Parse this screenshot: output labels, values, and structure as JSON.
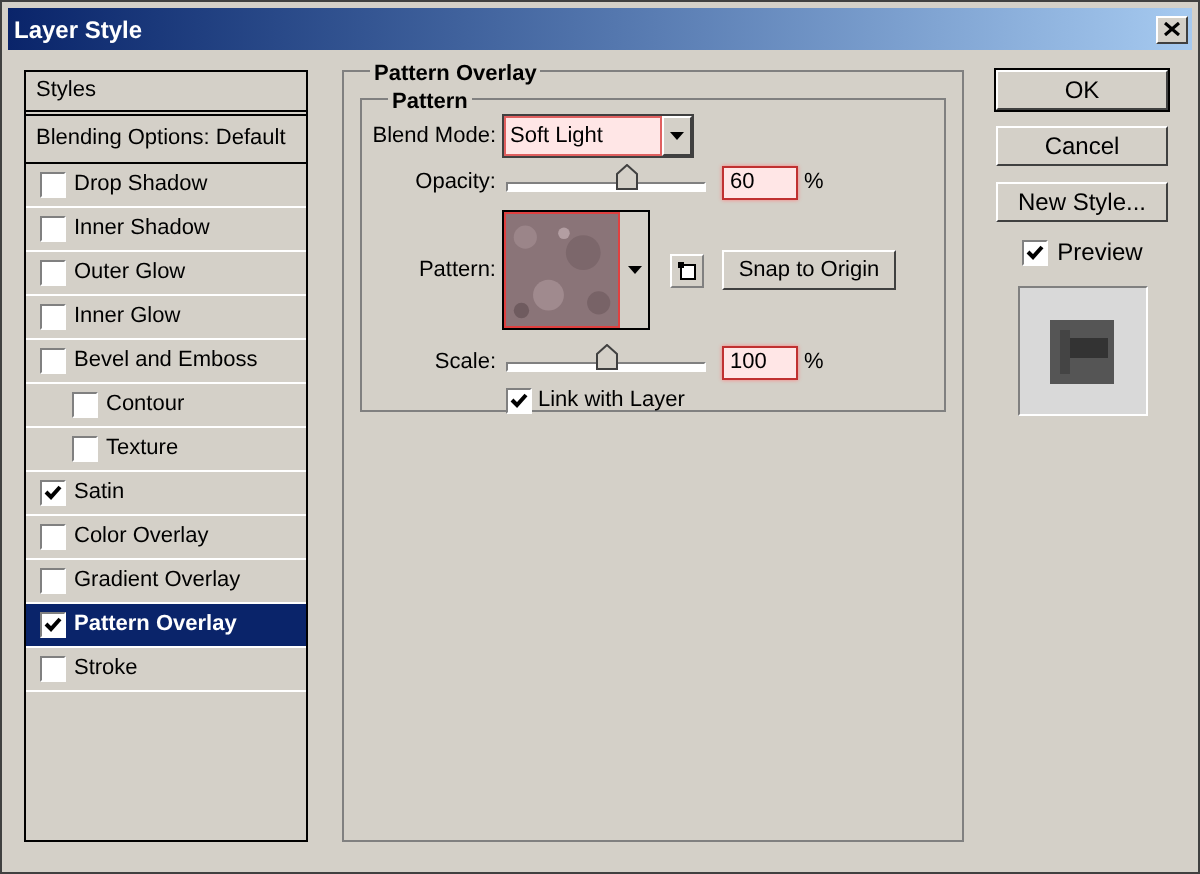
{
  "window": {
    "title": "Layer Style"
  },
  "styles_panel": {
    "header": "Styles",
    "blending": "Blending Options: Default",
    "items": [
      {
        "label": "Drop Shadow",
        "checked": false,
        "selected": false
      },
      {
        "label": "Inner Shadow",
        "checked": false,
        "selected": false
      },
      {
        "label": "Outer Glow",
        "checked": false,
        "selected": false
      },
      {
        "label": "Inner Glow",
        "checked": false,
        "selected": false
      },
      {
        "label": "Bevel and Emboss",
        "checked": false,
        "selected": false,
        "children": [
          {
            "label": "Contour",
            "checked": false,
            "selected": false
          },
          {
            "label": "Texture",
            "checked": false,
            "selected": false
          }
        ]
      },
      {
        "label": "Satin",
        "checked": true,
        "selected": false
      },
      {
        "label": "Color Overlay",
        "checked": false,
        "selected": false
      },
      {
        "label": "Gradient Overlay",
        "checked": false,
        "selected": false
      },
      {
        "label": "Pattern Overlay",
        "checked": true,
        "selected": true
      },
      {
        "label": "Stroke",
        "checked": false,
        "selected": false
      }
    ]
  },
  "pattern_overlay": {
    "title": "Pattern Overlay",
    "group": "Pattern",
    "blend_mode": {
      "label": "Blend Mode:",
      "value": "Soft Light"
    },
    "opacity": {
      "label": "Opacity:",
      "level": 0.6,
      "value": "60",
      "unit": "%"
    },
    "pattern": {
      "label": "Pattern:",
      "snap_button": "Snap to Origin"
    },
    "scale": {
      "label": "Scale:",
      "level": 0.5,
      "value": "100",
      "unit": "%"
    },
    "link_with_layer": {
      "label": "Link with Layer",
      "checked": true
    }
  },
  "buttons": [
    "OK",
    "Cancel",
    "New Style..."
  ],
  "preview": {
    "label": "Preview",
    "checked": true
  }
}
